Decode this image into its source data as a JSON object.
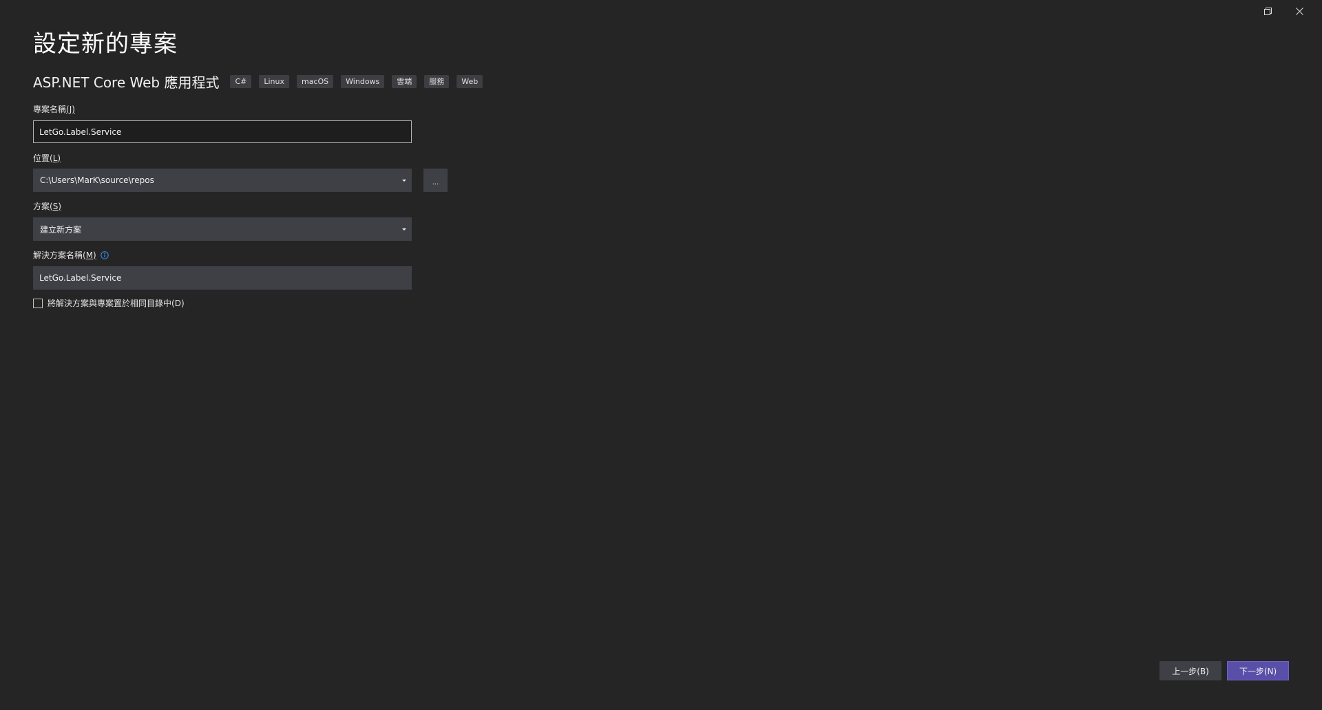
{
  "page_title": "設定新的專案",
  "template": {
    "name": "ASP.NET Core Web 應用程式",
    "tags": [
      "C#",
      "Linux",
      "macOS",
      "Windows",
      "雲端",
      "服務",
      "Web"
    ]
  },
  "project_name": {
    "label": "專案名稱",
    "hotkey": "(J)",
    "value": "LetGo.Label.Service"
  },
  "location": {
    "label": "位置",
    "hotkey": "(L)",
    "value": "C:\\Users\\MarK\\source\\repos",
    "browse_label": "..."
  },
  "solution": {
    "label": "方案",
    "hotkey": "(S)",
    "value": "建立新方案"
  },
  "solution_name": {
    "label": "解決方案名稱",
    "hotkey": "(M)",
    "value": "LetGo.Label.Service"
  },
  "same_dir_checkbox": {
    "label": "將解決方案與專案置於相同目錄中",
    "hotkey": "(D)",
    "checked": false
  },
  "footer": {
    "back_label": "上一步(B)",
    "next_label": "下一步(N)"
  },
  "colors": {
    "background": "#252526",
    "accent": "#5a4fa8",
    "info": "#3794ff"
  },
  "icons": {
    "restore": "restore-icon",
    "close": "close-icon",
    "info": "info-icon",
    "dropdown": "chevron-down-icon"
  }
}
